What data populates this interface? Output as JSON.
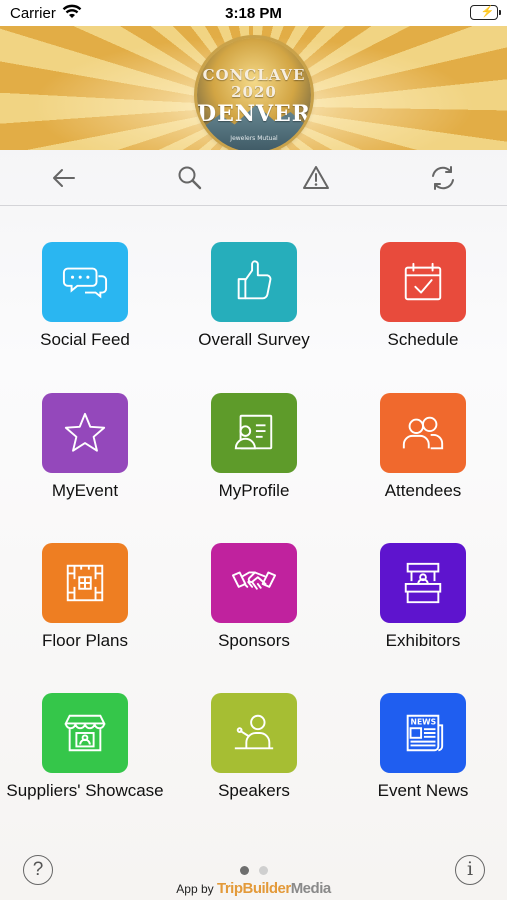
{
  "status_bar": {
    "carrier": "Carrier",
    "time": "3:18 PM"
  },
  "banner": {
    "logo_line1": "CONCLAVE",
    "logo_line2": "2020",
    "logo_line3": "DENVER",
    "logo_line4": "Jewelers Mutual"
  },
  "toolbar": {
    "items": [
      {
        "name": "back",
        "icon": "arrow-left-icon"
      },
      {
        "name": "search",
        "icon": "search-icon"
      },
      {
        "name": "alert",
        "icon": "warning-icon"
      },
      {
        "name": "refresh",
        "icon": "refresh-icon"
      }
    ]
  },
  "tiles": [
    {
      "label": "Social Feed",
      "color": "#2ab6f1",
      "icon": "chat-bubbles-icon"
    },
    {
      "label": "Overall Survey",
      "color": "#26aebb",
      "icon": "thumbs-up-icon"
    },
    {
      "label": "Schedule",
      "color": "#e84b3c",
      "icon": "calendar-check-icon"
    },
    {
      "label": "MyEvent",
      "color": "#9448bb",
      "icon": "star-icon"
    },
    {
      "label": "MyProfile",
      "color": "#5e9b2a",
      "icon": "profile-card-icon"
    },
    {
      "label": "Attendees",
      "color": "#f0692d",
      "icon": "people-icon"
    },
    {
      "label": "Floor Plans",
      "color": "#ee7e22",
      "icon": "floor-plan-icon"
    },
    {
      "label": "Sponsors",
      "color": "#c0229e",
      "icon": "handshake-icon"
    },
    {
      "label": "Exhibitors",
      "color": "#5e14ce",
      "icon": "booth-icon"
    },
    {
      "label": "Suppliers' Showcase",
      "color": "#35c64a",
      "icon": "storefront-icon"
    },
    {
      "label": "Speakers",
      "color": "#a6be33",
      "icon": "speaker-podium-icon"
    },
    {
      "label": "Event News",
      "color": "#1f5ef0",
      "icon": "newspaper-icon"
    }
  ],
  "pager": {
    "pages": 2,
    "current": 1,
    "active_color": "#6e6e6e",
    "inactive_color": "#cfcfcf"
  },
  "footer": {
    "help_glyph": "?",
    "info_glyph": "i",
    "credit_prefix": "App by",
    "brand_part1": "TripBuilder",
    "brand_part2": "Media"
  }
}
